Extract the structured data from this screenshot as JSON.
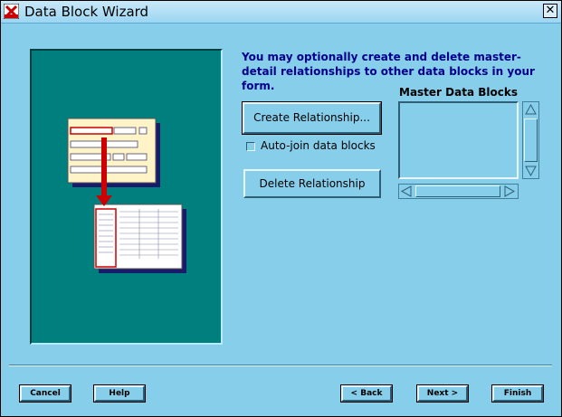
{
  "window": {
    "title": "Data Block Wizard",
    "close_symbol": "✕"
  },
  "intro_text": "You may optionally create and delete master-detail relationships to other data blocks in your form.",
  "buttons": {
    "create_relationship": "Create Relationship...",
    "delete_relationship": "Delete Relationship"
  },
  "autojoin": {
    "label": "Auto-join data blocks",
    "checked": false
  },
  "master_list": {
    "label": "Master Data Blocks",
    "items": []
  },
  "footer": {
    "cancel": "Cancel",
    "help": "Help",
    "back": "< Back",
    "next": "Next >",
    "finish": "Finish"
  },
  "colors": {
    "window_bg": "#87CEEB",
    "illustration_bg": "#007f7f",
    "intro_text": "#00008b",
    "arrow": "#cc0000"
  },
  "icons": {
    "app": "oracle-forms-icon",
    "close": "close-icon",
    "scroll_up": "scroll-up-arrow-icon",
    "scroll_down": "scroll-down-arrow-icon",
    "scroll_left": "scroll-left-arrow-icon",
    "scroll_right": "scroll-right-arrow-icon"
  }
}
